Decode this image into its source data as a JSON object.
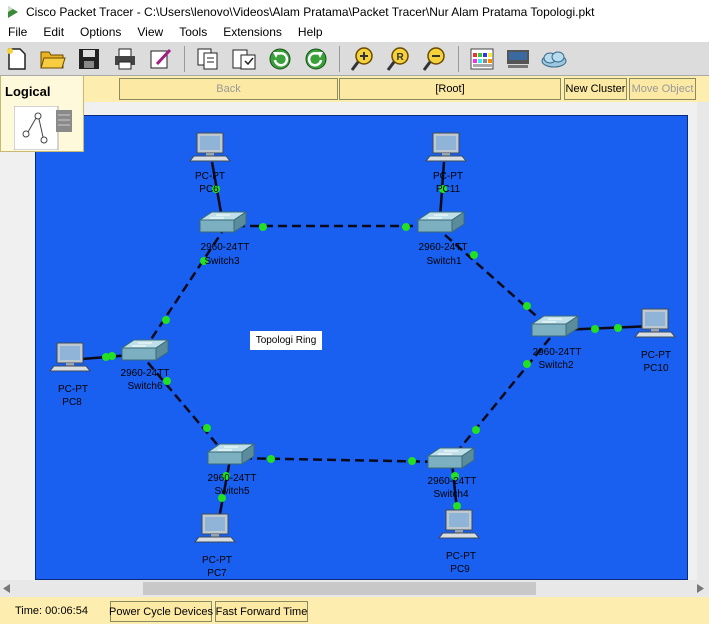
{
  "window": {
    "title": "Cisco Packet Tracer - C:\\Users\\lenovo\\Videos\\Alam Pratama\\Packet Tracer\\Nur Alam Pratama Topologi.pkt"
  },
  "menu": [
    "File",
    "Edit",
    "Options",
    "View",
    "Tools",
    "Extensions",
    "Help"
  ],
  "toolbar_icons": [
    "new-file-icon",
    "open-folder-icon",
    "save-icon",
    "print-icon",
    "activity-wizard-icon",
    "copy-icon",
    "paste-icon",
    "undo-icon",
    "redo-icon",
    "zoom-in-icon",
    "zoom-reset-icon",
    "zoom-out-icon",
    "palette-icon",
    "custom-device-icon",
    "cloud-icon"
  ],
  "nav": {
    "workspace_label": "Logical",
    "back_label": "Back",
    "path_label": "[Root]",
    "new_cluster_label": "New Cluster",
    "move_object_label": "Move Object"
  },
  "canvas": {
    "note": "Topologi Ring",
    "devices": [
      {
        "id": "sw3",
        "model": "2960-24TT",
        "name": "Switch3"
      },
      {
        "id": "sw1",
        "model": "2960-24TT",
        "name": "Switch1"
      },
      {
        "id": "sw2",
        "model": "2960-24TT",
        "name": "Switch2"
      },
      {
        "id": "sw4",
        "model": "2960-24TT",
        "name": "Switch4"
      },
      {
        "id": "sw5",
        "model": "2960-24TT",
        "name": "Switch5"
      },
      {
        "id": "sw6",
        "model": "2960-24TT",
        "name": "Switch6"
      },
      {
        "id": "pc6",
        "model": "PC-PT",
        "name": "PC6"
      },
      {
        "id": "pc11",
        "model": "PC-PT",
        "name": "PC11"
      },
      {
        "id": "pc10",
        "model": "PC-PT",
        "name": "PC10"
      },
      {
        "id": "pc9",
        "model": "PC-PT",
        "name": "PC9"
      },
      {
        "id": "pc7",
        "model": "PC-PT",
        "name": "PC7"
      },
      {
        "id": "pc8",
        "model": "PC-PT",
        "name": "PC8"
      }
    ]
  },
  "status": {
    "time": "Time: 00:06:54",
    "power_cycle_label": "Power Cycle Devices",
    "fast_forward_label": "Fast Forward Time"
  },
  "colors": {
    "canvas": "#1960f0",
    "link_light": "#22e022",
    "panel": "#fdeeb0"
  }
}
